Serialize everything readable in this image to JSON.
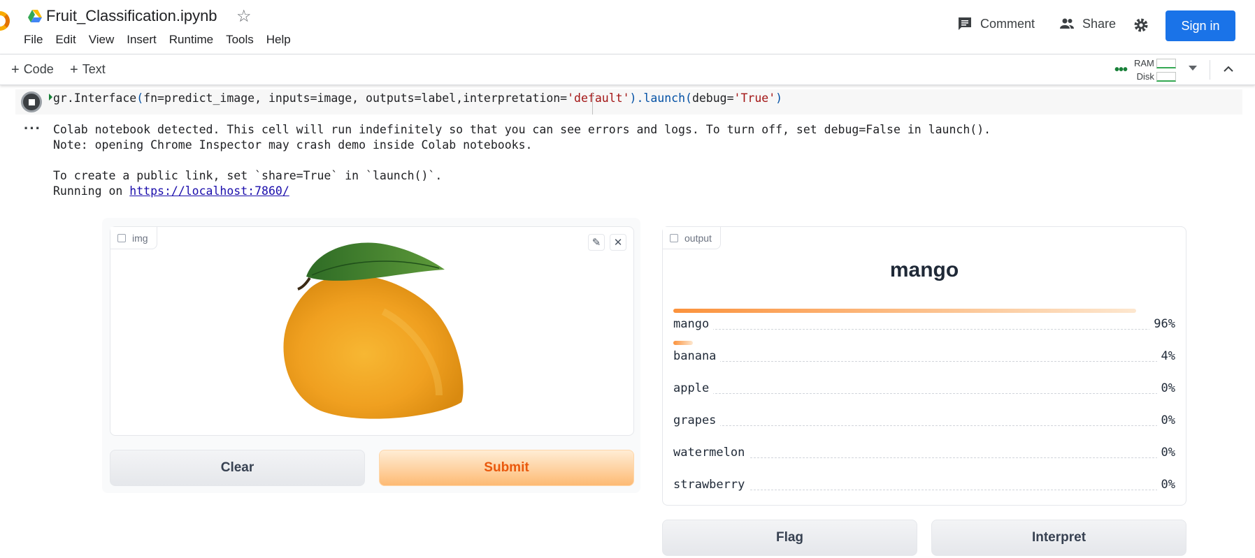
{
  "header": {
    "title": "Fruit_Classification.ipynb",
    "menu": [
      "File",
      "Edit",
      "View",
      "Insert",
      "Runtime",
      "Tools",
      "Help"
    ],
    "comment_label": "Comment",
    "share_label": "Share",
    "signin_label": "Sign in"
  },
  "toolbar": {
    "code_label": "Code",
    "text_label": "Text",
    "ram_label": "RAM",
    "disk_label": "Disk"
  },
  "cell": {
    "code_parts": {
      "p1": "gr.Interface",
      "p2": "(",
      "p3": "fn=predict_image, inputs=image, outputs=label,interpretation=",
      "p4": "'default'",
      "p5": ").launch(",
      "p6": "debug=",
      "p7": "'True'",
      "p8": ")"
    },
    "output_lines": [
      "Colab notebook detected. This cell will run indefinitely so that you can see errors and logs. To turn off, set debug=False in launch().",
      "Note: opening Chrome Inspector may crash demo inside Colab notebooks.",
      "",
      "To create a public link, set `share=True` in `launch()`."
    ],
    "running_prefix": "Running on ",
    "running_link": "https://localhost:7860/"
  },
  "gradio": {
    "input_tag": "img",
    "output_tag": "output",
    "predicted_label": "mango",
    "confidences": [
      {
        "label": "mango",
        "percent": "96%",
        "value": 0.96
      },
      {
        "label": "banana",
        "percent": "4%",
        "value": 0.04
      },
      {
        "label": "apple",
        "percent": "0%",
        "value": 0
      },
      {
        "label": "grapes",
        "percent": "0%",
        "value": 0
      },
      {
        "label": "watermelon",
        "percent": "0%",
        "value": 0
      },
      {
        "label": "strawberry",
        "percent": "0%",
        "value": 0
      }
    ],
    "buttons": {
      "clear": "Clear",
      "submit": "Submit",
      "flag": "Flag",
      "interpret": "Interpret"
    }
  },
  "colors": {
    "accent": "#1a73e8",
    "submit_text": "#ea580c",
    "bar_start": "#fb923c"
  }
}
